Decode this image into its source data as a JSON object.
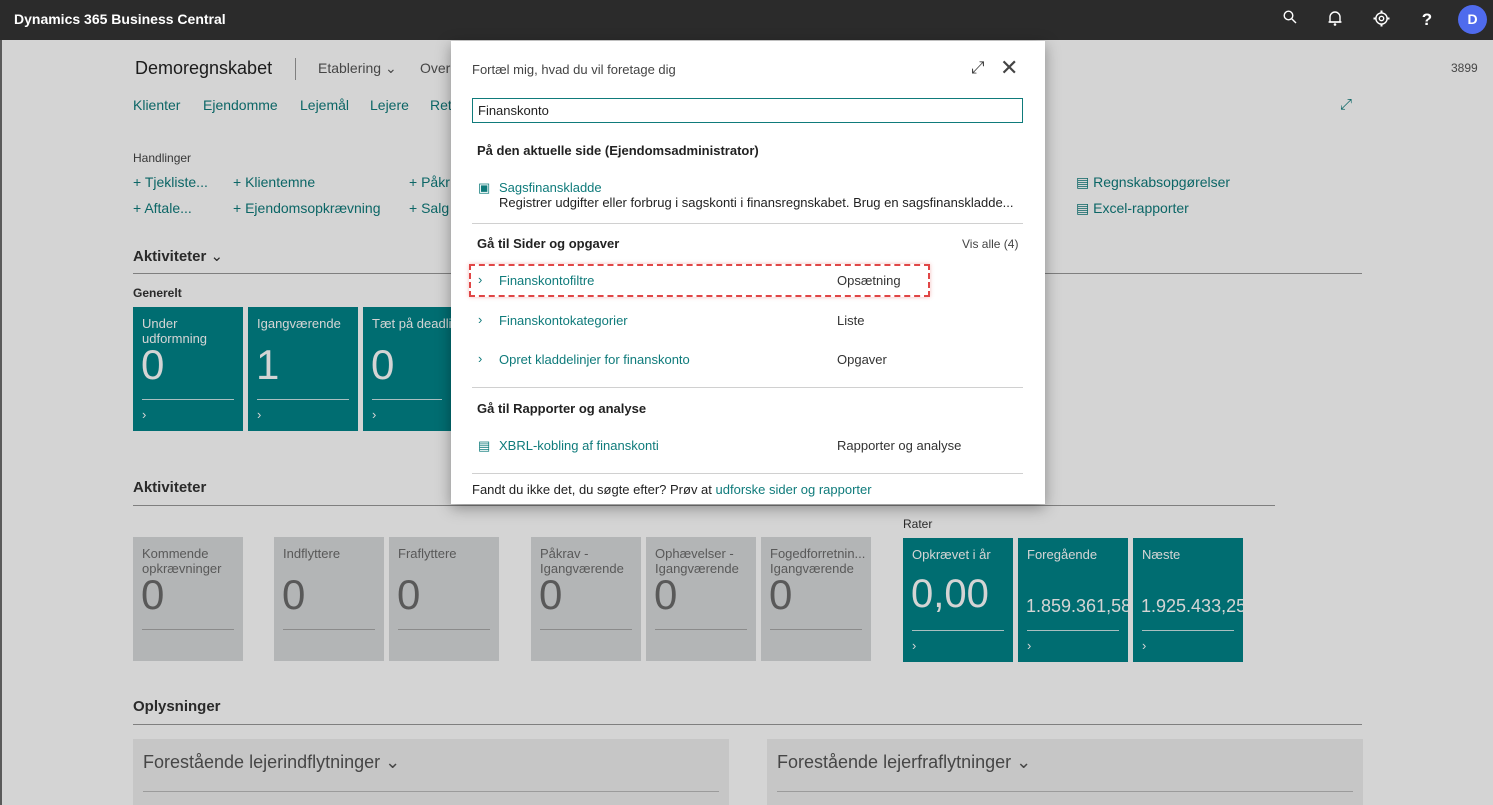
{
  "topbar": {
    "app_title": "Dynamics 365 Business Central",
    "icons": [
      "search-icon",
      "bell-icon",
      "gear-icon",
      "help-icon"
    ],
    "avatar_initial": "D"
  },
  "page": {
    "company": "Demoregnskabet",
    "menu": [
      "Etablering",
      "Over"
    ],
    "page_number": "3899",
    "nav": [
      "Klienter",
      "Ejendomme",
      "Lejemål",
      "Lejere",
      "Ret"
    ],
    "actions_label": "Handlinger",
    "actions": [
      {
        "label": "Tjekliste..."
      },
      {
        "label": "Klientemne"
      },
      {
        "label": "Påkr"
      },
      {
        "label": "Aftale..."
      },
      {
        "label": "Ejendomsopkrævning"
      },
      {
        "label": "Salg"
      }
    ],
    "reports": [
      "Regnskabsopgørelser",
      "Excel-rapporter"
    ],
    "aktiviteter1": "Aktiviteter",
    "generelt": "Generelt",
    "tiles_top": [
      {
        "label": "Under udformning",
        "value": "0"
      },
      {
        "label": "Igangværende",
        "value": "1"
      },
      {
        "label": "Tæt på deadlin",
        "value": "0"
      }
    ],
    "aktiviteter2": "Aktiviteter",
    "tiles_bottom": [
      {
        "label": "Kommende opkrævninger",
        "value": "0"
      },
      {
        "label": "Indflyttere",
        "value": "0"
      },
      {
        "label": "Fraflyttere",
        "value": "0"
      },
      {
        "label": "Påkrav - Igangværende",
        "value": "0"
      },
      {
        "label": "Ophævelser - Igangværende",
        "value": "0"
      },
      {
        "label": "Fogedforretnin... Igangværende",
        "value": "0"
      }
    ],
    "rater_label": "Rater",
    "rater_tiles": [
      {
        "label": "Opkrævet i år",
        "value": "0,00"
      },
      {
        "label": "Foregående",
        "value": "1.859.361,58"
      },
      {
        "label": "Næste",
        "value": "1.925.433,25"
      }
    ],
    "oplysninger": "Oplysninger",
    "info_panels": [
      "Forestående lejerindflytninger",
      "Forestående lejerfraflytninger"
    ]
  },
  "dialog": {
    "title": "Fortæl mig, hvad du vil foretage dig",
    "search_value": "Finanskonto",
    "section_current": "På den aktuelle side (Ejendomsadministrator)",
    "current_item": {
      "label": "Sagsfinanskladde",
      "description": "Registrer udgifter eller forbrug i sagskonti i finansregnskabet. Brug en sagsfinanskladde..."
    },
    "section_pages": "Gå til Sider og opgaver",
    "see_all": "Vis alle (4)",
    "pages": [
      {
        "label": "Finanskontofiltre",
        "category": "Opsætning"
      },
      {
        "label": "Finanskontokategorier",
        "category": "Liste"
      },
      {
        "label": "Opret kladdelinjer for finanskonto",
        "category": "Opgaver"
      }
    ],
    "section_reports": "Gå til Rapporter og analyse",
    "reports": [
      {
        "label": "XBRL-kobling af finanskonti",
        "category": "Rapporter og analyse"
      }
    ],
    "footer_text": "Fandt du ikke det, du søgte efter? Prøv at ",
    "footer_link": "udforske sider og rapporter"
  },
  "colors": {
    "accent": "#0f7b7b",
    "tile_teal": "#008489",
    "highlight": "#e04646",
    "topbar": "#2b2b2b"
  }
}
